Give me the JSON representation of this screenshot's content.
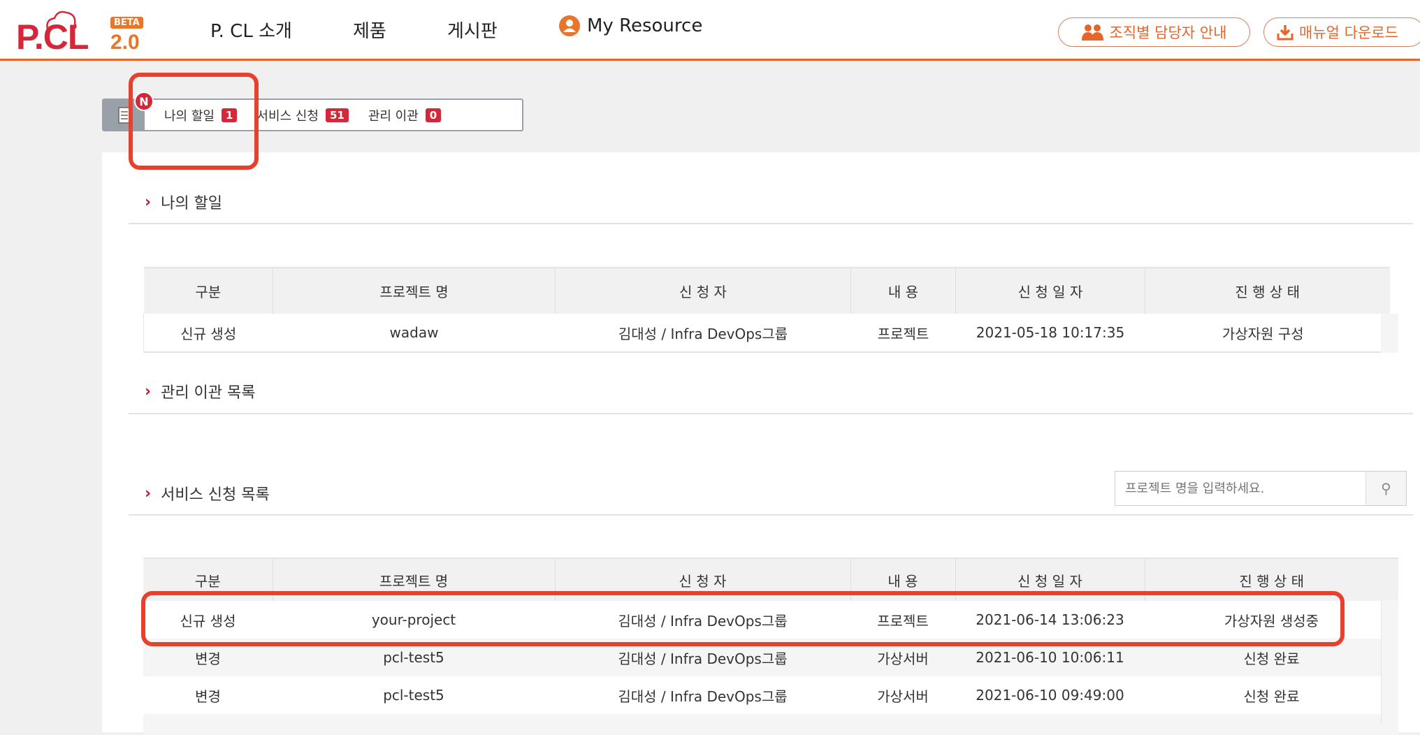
{
  "header": {
    "logo": "P.CL",
    "beta": "BETA",
    "version": "2.0",
    "nav": [
      "P. CL 소개",
      "제품",
      "게시판",
      "My Resource"
    ],
    "buttons": {
      "contacts": "조직별 담당자 안내",
      "manual": "매뉴얼 다운로드"
    }
  },
  "tabs": {
    "new_badge": "N",
    "items": [
      {
        "label": "나의 할일",
        "count": "1"
      },
      {
        "label": "서비스 신청",
        "count": "51"
      },
      {
        "label": "관리 이관",
        "count": "0"
      }
    ]
  },
  "sections": {
    "todo": "나의 할일",
    "transfer": "관리 이관 목록",
    "service": "서비스 신청 목록"
  },
  "search": {
    "placeholder": "프로젝트 명을 입력하세요."
  },
  "columns": [
    "구분",
    "프로젝트 명",
    "신 청 자",
    "내 용",
    "신 청 일 자",
    "진 행 상 태"
  ],
  "todo_rows": [
    [
      "신규 생성",
      "wadaw",
      "김대성 / Infra DevOps그룹",
      "프로젝트",
      "2021-05-18 10:17:35",
      "가상자원 구성"
    ]
  ],
  "service_rows": [
    [
      "신규 생성",
      "your-project",
      "김대성 / Infra DevOps그룹",
      "프로젝트",
      "2021-06-14 13:06:23",
      "가상자원 생성중"
    ],
    [
      "변경",
      "pcl-test5",
      "김대성 / Infra DevOps그룹",
      "가상서버",
      "2021-06-10 10:06:11",
      "신청 완료"
    ],
    [
      "변경",
      "pcl-test5",
      "김대성 / Infra DevOps그룹",
      "가상서버",
      "2021-06-10 09:49:00",
      "신청 완료"
    ]
  ]
}
